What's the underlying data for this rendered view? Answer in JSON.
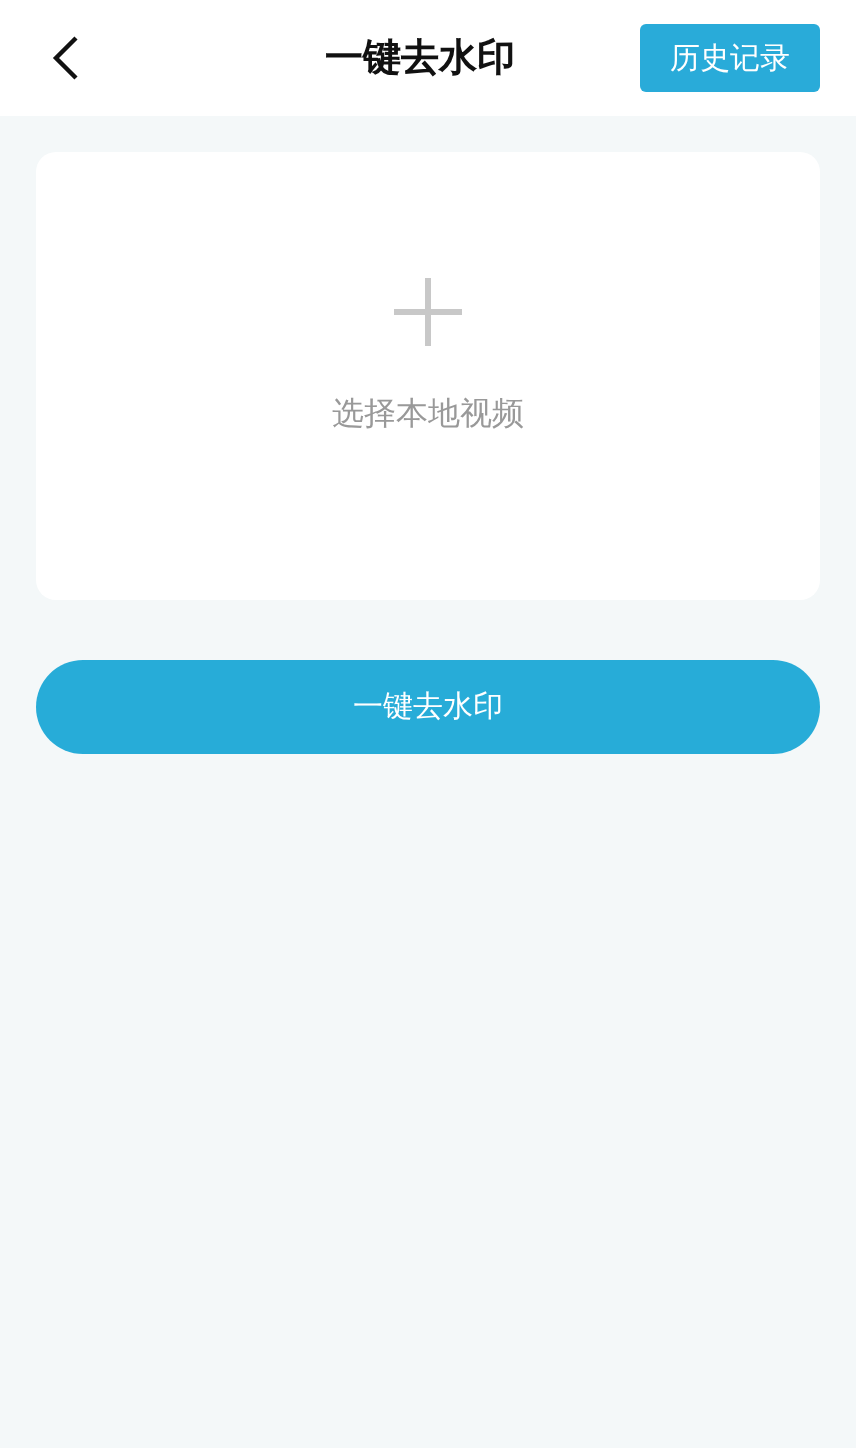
{
  "header": {
    "title": "一键去水印",
    "history_button": "历史记录"
  },
  "upload_card": {
    "label": "选择本地视频"
  },
  "action_button": "一键去水印"
}
